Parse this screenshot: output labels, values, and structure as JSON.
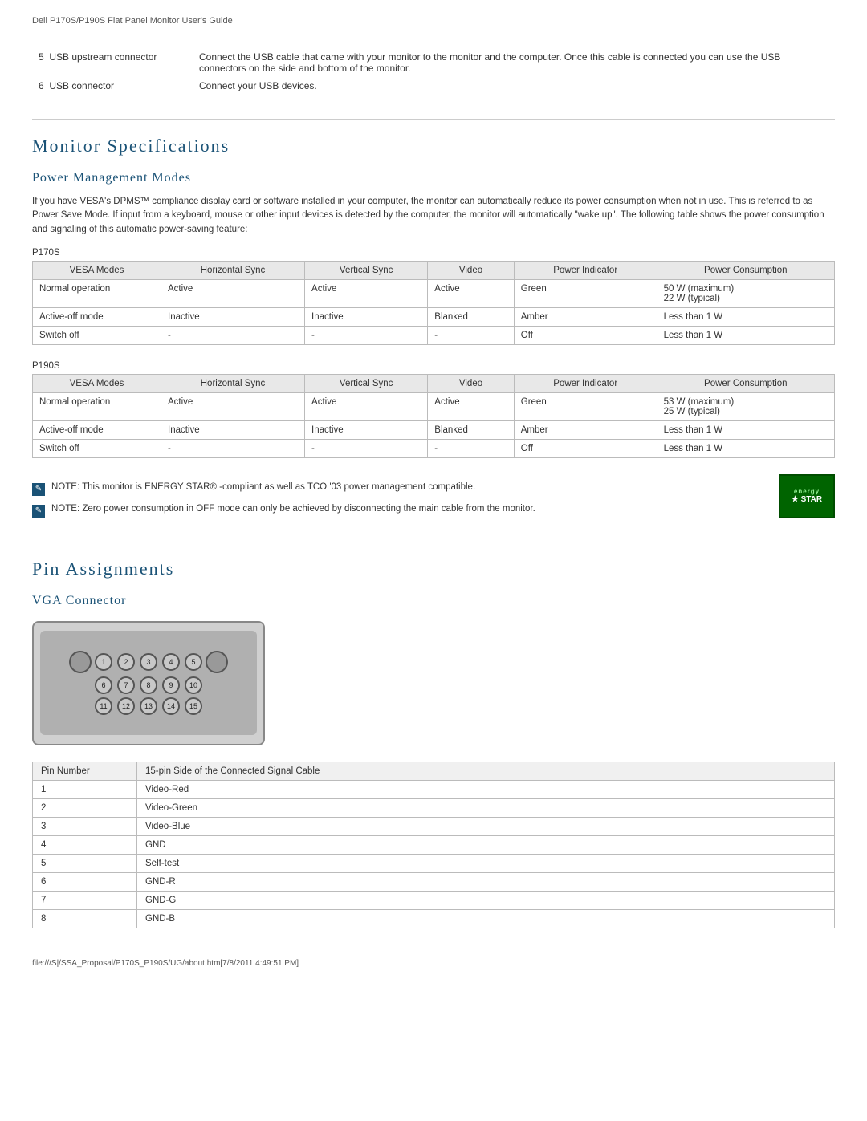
{
  "header": {
    "title": "Dell P170S/P190S Flat Panel Monitor User's Guide"
  },
  "usb_section": {
    "items": [
      {
        "number": "5",
        "label": "USB upstream connector",
        "description": "Connect the USB cable that came with your monitor to the monitor and the computer. Once this cable is connected you can use the USB connectors on the side and bottom of the monitor."
      },
      {
        "number": "6",
        "label": "USB connector",
        "description": "Connect your USB devices."
      }
    ]
  },
  "monitor_specs": {
    "section_title": "Monitor Specifications",
    "power_management": {
      "subtitle": "Power Management Modes",
      "intro_text": "If you have VESA's DPMS™ compliance display card or software installed in your computer, the monitor can automatically reduce its power consumption when not in use. This is referred to as Power Save Mode. If input from a keyboard, mouse or other input devices is detected by the computer, the monitor will automatically \"wake up\". The following table shows the power consumption and signaling of this automatic power-saving feature:",
      "p170s_label": "P170S",
      "p190s_label": "P190S",
      "table_headers": [
        "VESA Modes",
        "Horizontal Sync",
        "Vertical Sync",
        "Video",
        "Power Indicator",
        "Power Consumption"
      ],
      "p170s_rows": [
        {
          "mode": "Normal operation",
          "hsync": "Active",
          "vsync": "Active",
          "video": "Active",
          "indicator": "Green",
          "consumption": "50 W (maximum)\n22 W (typical)"
        },
        {
          "mode": "Active-off mode",
          "hsync": "Inactive",
          "vsync": "Inactive",
          "video": "Blanked",
          "indicator": "Amber",
          "consumption": "Less than 1 W"
        },
        {
          "mode": "Switch off",
          "hsync": "-",
          "vsync": "-",
          "video": "-",
          "indicator": "Off",
          "consumption": "Less than 1 W"
        }
      ],
      "p190s_rows": [
        {
          "mode": "Normal operation",
          "hsync": "Active",
          "vsync": "Active",
          "video": "Active",
          "indicator": "Green",
          "consumption": "53 W (maximum)\n25 W (typical)"
        },
        {
          "mode": "Active-off mode",
          "hsync": "Inactive",
          "vsync": "Inactive",
          "video": "Blanked",
          "indicator": "Amber",
          "consumption": "Less than 1 W"
        },
        {
          "mode": "Switch off",
          "hsync": "-",
          "vsync": "-",
          "video": "-",
          "indicator": "Off",
          "consumption": "Less than 1 W"
        }
      ],
      "note1": "NOTE: This monitor is ENERGY STAR® -compliant as well as TCO '03 power management compatible.",
      "note2": "NOTE: Zero power consumption in OFF mode can only be achieved by disconnecting the main cable from the monitor.",
      "energy_star_line1": "energy",
      "energy_star_line2": "★ STAR"
    }
  },
  "pin_assignments": {
    "section_title": "Pin Assignments",
    "vga_connector": {
      "subtitle": "VGA Connector",
      "pin_rows": [
        {
          "row": [
            1,
            2,
            3,
            4,
            5
          ]
        },
        {
          "row": [
            6,
            7,
            8,
            9,
            10
          ]
        },
        {
          "row": [
            11,
            12,
            13,
            14,
            15
          ]
        }
      ],
      "table_headers": [
        "Pin Number",
        "15-pin Side of the Connected Signal Cable"
      ],
      "pins": [
        {
          "number": "1",
          "signal": "Video-Red"
        },
        {
          "number": "2",
          "signal": "Video-Green"
        },
        {
          "number": "3",
          "signal": "Video-Blue"
        },
        {
          "number": "4",
          "signal": "GND"
        },
        {
          "number": "5",
          "signal": "Self-test"
        },
        {
          "number": "6",
          "signal": "GND-R"
        },
        {
          "number": "7",
          "signal": "GND-G"
        },
        {
          "number": "8",
          "signal": "GND-B"
        }
      ]
    }
  },
  "footer": {
    "text": "file:///S|/SSA_Proposal/P170S_P190S/UG/about.htm[7/8/2011 4:49:51 PM]"
  }
}
